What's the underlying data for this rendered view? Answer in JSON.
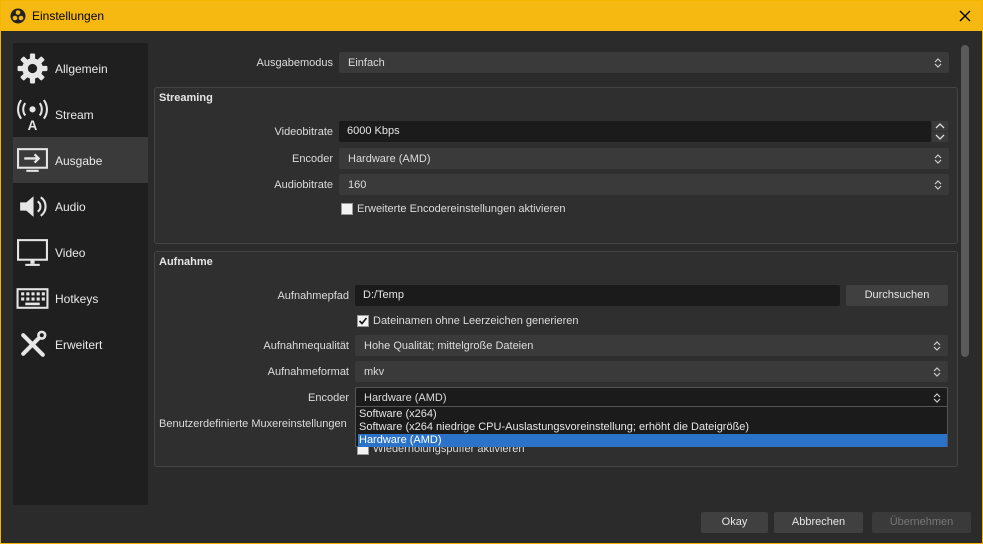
{
  "window": {
    "title": "Einstellungen"
  },
  "sidebar": {
    "items": [
      {
        "label": "Allgemein",
        "icon": "gear-icon"
      },
      {
        "label": "Stream",
        "icon": "broadcast-icon"
      },
      {
        "label": "Ausgabe",
        "icon": "output-icon",
        "active": true
      },
      {
        "label": "Audio",
        "icon": "speaker-icon"
      },
      {
        "label": "Video",
        "icon": "monitor-icon"
      },
      {
        "label": "Hotkeys",
        "icon": "keyboard-icon"
      },
      {
        "label": "Erweitert",
        "icon": "tools-icon"
      }
    ]
  },
  "output_mode": {
    "label": "Ausgabemodus",
    "value": "Einfach"
  },
  "streaming": {
    "title": "Streaming",
    "video_bitrate": {
      "label": "Videobitrate",
      "value": "6000 Kbps"
    },
    "encoder": {
      "label": "Encoder",
      "value": "Hardware (AMD)"
    },
    "audio_bitrate": {
      "label": "Audiobitrate",
      "value": "160"
    },
    "advanced_checkbox": {
      "label": "Erweiterte Encodereinstellungen aktivieren",
      "checked": false
    }
  },
  "recording": {
    "title": "Aufnahme",
    "path": {
      "label": "Aufnahmepfad",
      "value": "D:/Temp",
      "browse": "Durchsuchen"
    },
    "no_spaces_checkbox": {
      "label": "Dateinamen ohne Leerzeichen generieren",
      "checked": true
    },
    "quality": {
      "label": "Aufnahmequalität",
      "value": "Hohe Qualität; mittelgroße Dateien"
    },
    "format": {
      "label": "Aufnahmeformat",
      "value": "mkv"
    },
    "encoder": {
      "label": "Encoder",
      "value": "Hardware (AMD)",
      "options": [
        "Software (x264)",
        "Software (x264 niedrige CPU-Auslastungsvoreinstellung; erhöht die Dateigröße)",
        "Hardware (AMD)"
      ],
      "selected_index": 2
    },
    "mux_label": "Benutzerdefinierte Muxereinstellungen",
    "replay_checkbox": {
      "label": "Wiederholungspuffer aktivieren",
      "checked": false
    }
  },
  "footer": {
    "ok": "Okay",
    "cancel": "Abbrechen",
    "apply": "Übernehmen"
  },
  "colors": {
    "accent": "#f6b912",
    "selection": "#2a73c9",
    "background": "#2b2b2b"
  }
}
